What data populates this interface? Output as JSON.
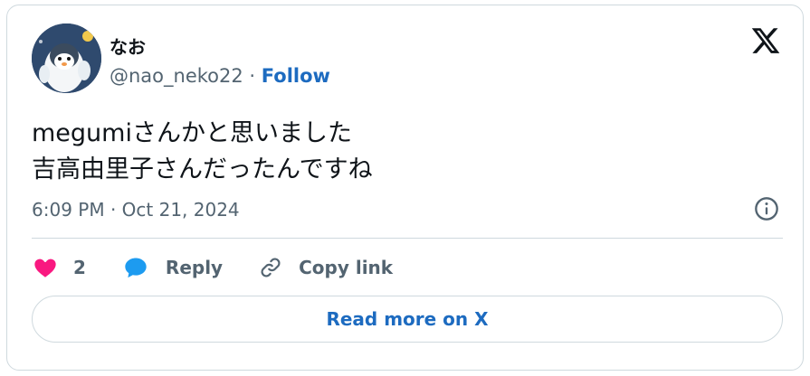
{
  "author": {
    "display_name": "なお",
    "handle": "@nao_neko22",
    "separator": " · ",
    "follow_label": "Follow"
  },
  "tweet": {
    "lines": [
      "megumiさんかと思いました",
      "吉高由里子さんだったんですね"
    ],
    "timestamp": "6:09 PM · Oct 21, 2024"
  },
  "actions": {
    "like_count": "2",
    "reply_label": "Reply",
    "copy_link_label": "Copy link"
  },
  "read_more_label": "Read more on X",
  "colors": {
    "accent": "#1d6bc0",
    "like": "#f91880",
    "reply": "#1d9bf0",
    "muted": "#536471",
    "border": "#cfd9de"
  },
  "icons": {
    "logo": "x-logo-icon",
    "info": "info-icon",
    "like": "heart-icon",
    "reply": "speech-bubble-icon",
    "copy_link": "link-icon"
  }
}
